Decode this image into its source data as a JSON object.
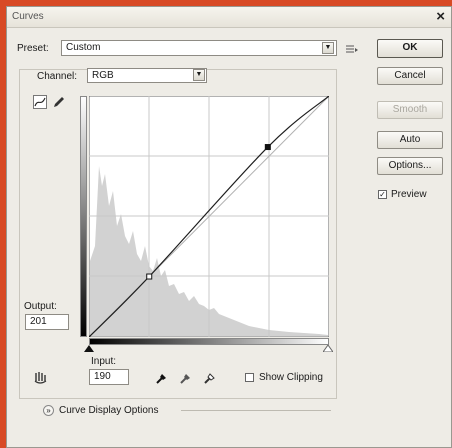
{
  "window": {
    "title": "Curves",
    "close_glyph": "×"
  },
  "preset": {
    "label": "Preset:",
    "value": "Custom"
  },
  "channel": {
    "label": "Channel:",
    "value": "RGB"
  },
  "buttons": {
    "ok": "OK",
    "cancel": "Cancel",
    "smooth": "Smooth",
    "auto": "Auto",
    "options": "Options..."
  },
  "preview": {
    "label": "Preview",
    "checked": true
  },
  "output": {
    "label": "Output:",
    "value": "201"
  },
  "input": {
    "label": "Input:",
    "value": "190"
  },
  "show_clipping": {
    "label": "Show Clipping",
    "checked": false
  },
  "display_options": {
    "label": "Curve Display Options",
    "toggle_glyph": "»"
  },
  "curve": {
    "points_input_output": [
      [
        0,
        0
      ],
      [
        64,
        64
      ],
      [
        190,
        201
      ],
      [
        255,
        255
      ]
    ],
    "selected_point": [
      190,
      201
    ]
  },
  "colors": {
    "accent_background": "#d84a25",
    "dialog": "#eeece6",
    "histogram": "#d2d2d2",
    "curve_line": "#1e1e1e"
  },
  "icons": [
    "curve-tool-icon",
    "pencil-tool-icon",
    "options-menu-icon",
    "adjust-hand-icon",
    "black-eyedropper-icon",
    "gray-eyedropper-icon",
    "white-eyedropper-icon"
  ]
}
